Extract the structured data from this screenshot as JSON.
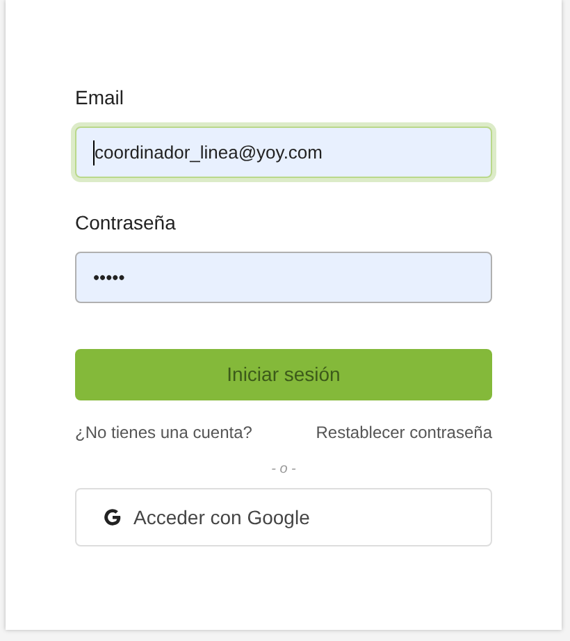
{
  "email": {
    "label": "Email",
    "value": "coordinador_linea@yoy.com",
    "focused": true
  },
  "password": {
    "label": "Contraseña",
    "value": "•••••",
    "focused": false
  },
  "submit": {
    "label": "Iniciar sesión"
  },
  "links": [
    {
      "label": "¿No tienes una cuenta?"
    },
    {
      "label": "Restablecer contraseña"
    }
  ],
  "divider": "- o -",
  "google_button": {
    "label": "Acceder con Google"
  }
}
